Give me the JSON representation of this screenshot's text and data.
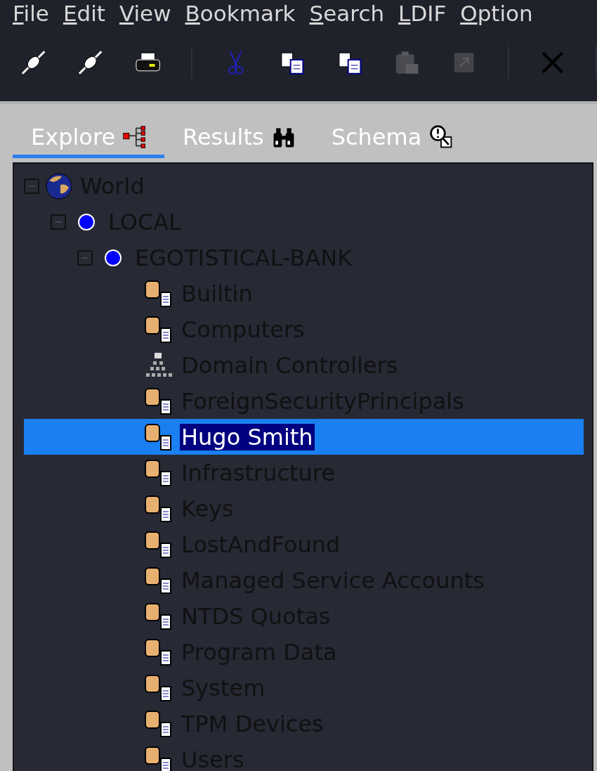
{
  "menu": [
    {
      "label": "File"
    },
    {
      "label": "Edit"
    },
    {
      "label": "View"
    },
    {
      "label": "Bookmark"
    },
    {
      "label": "Search"
    },
    {
      "label": "LDIF"
    },
    {
      "label": "Option"
    }
  ],
  "toolbar": [
    {
      "kind": "connect",
      "disabled": false
    },
    {
      "kind": "disconnect",
      "disabled": false
    },
    {
      "kind": "print",
      "disabled": false
    },
    {
      "kind": "separator"
    },
    {
      "kind": "cut",
      "disabled": false
    },
    {
      "kind": "copy",
      "disabled": false
    },
    {
      "kind": "copy-dn",
      "disabled": false
    },
    {
      "kind": "paste",
      "disabled": true
    },
    {
      "kind": "export",
      "disabled": true
    },
    {
      "kind": "separator"
    },
    {
      "kind": "delete",
      "disabled": false
    },
    {
      "kind": "separator"
    }
  ],
  "tabs": [
    {
      "label": "Explore",
      "kind": "explore",
      "selected": true
    },
    {
      "label": "Results",
      "kind": "results",
      "selected": false
    },
    {
      "label": "Schema",
      "kind": "schema",
      "selected": false
    }
  ],
  "tree": [
    {
      "label": "World",
      "kind": "globe",
      "expanded": true,
      "selected": false,
      "children": [
        {
          "label": "LOCAL",
          "kind": "server",
          "expanded": true,
          "selected": false,
          "children": [
            {
              "label": "EGOTISTICAL-BANK",
              "kind": "server",
              "expanded": true,
              "selected": false,
              "children": [
                {
                  "label": "Builtin",
                  "kind": "entry",
                  "selected": false
                },
                {
                  "label": "Computers",
                  "kind": "entry",
                  "selected": false
                },
                {
                  "label": "Domain Controllers",
                  "kind": "hierarchy",
                  "selected": false
                },
                {
                  "label": "ForeignSecurityPrincipals",
                  "kind": "entry",
                  "selected": false
                },
                {
                  "label": "Hugo Smith",
                  "kind": "entry",
                  "selected": true
                },
                {
                  "label": "Infrastructure",
                  "kind": "entry",
                  "selected": false
                },
                {
                  "label": "Keys",
                  "kind": "entry",
                  "selected": false
                },
                {
                  "label": "LostAndFound",
                  "kind": "entry",
                  "selected": false
                },
                {
                  "label": "Managed Service Accounts",
                  "kind": "entry",
                  "selected": false
                },
                {
                  "label": "NTDS Quotas",
                  "kind": "entry",
                  "selected": false
                },
                {
                  "label": "Program Data",
                  "kind": "entry",
                  "selected": false
                },
                {
                  "label": "System",
                  "kind": "entry",
                  "selected": false
                },
                {
                  "label": "TPM Devices",
                  "kind": "entry",
                  "selected": false
                },
                {
                  "label": "Users",
                  "kind": "entry",
                  "selected": false
                }
              ]
            }
          ]
        }
      ]
    }
  ]
}
